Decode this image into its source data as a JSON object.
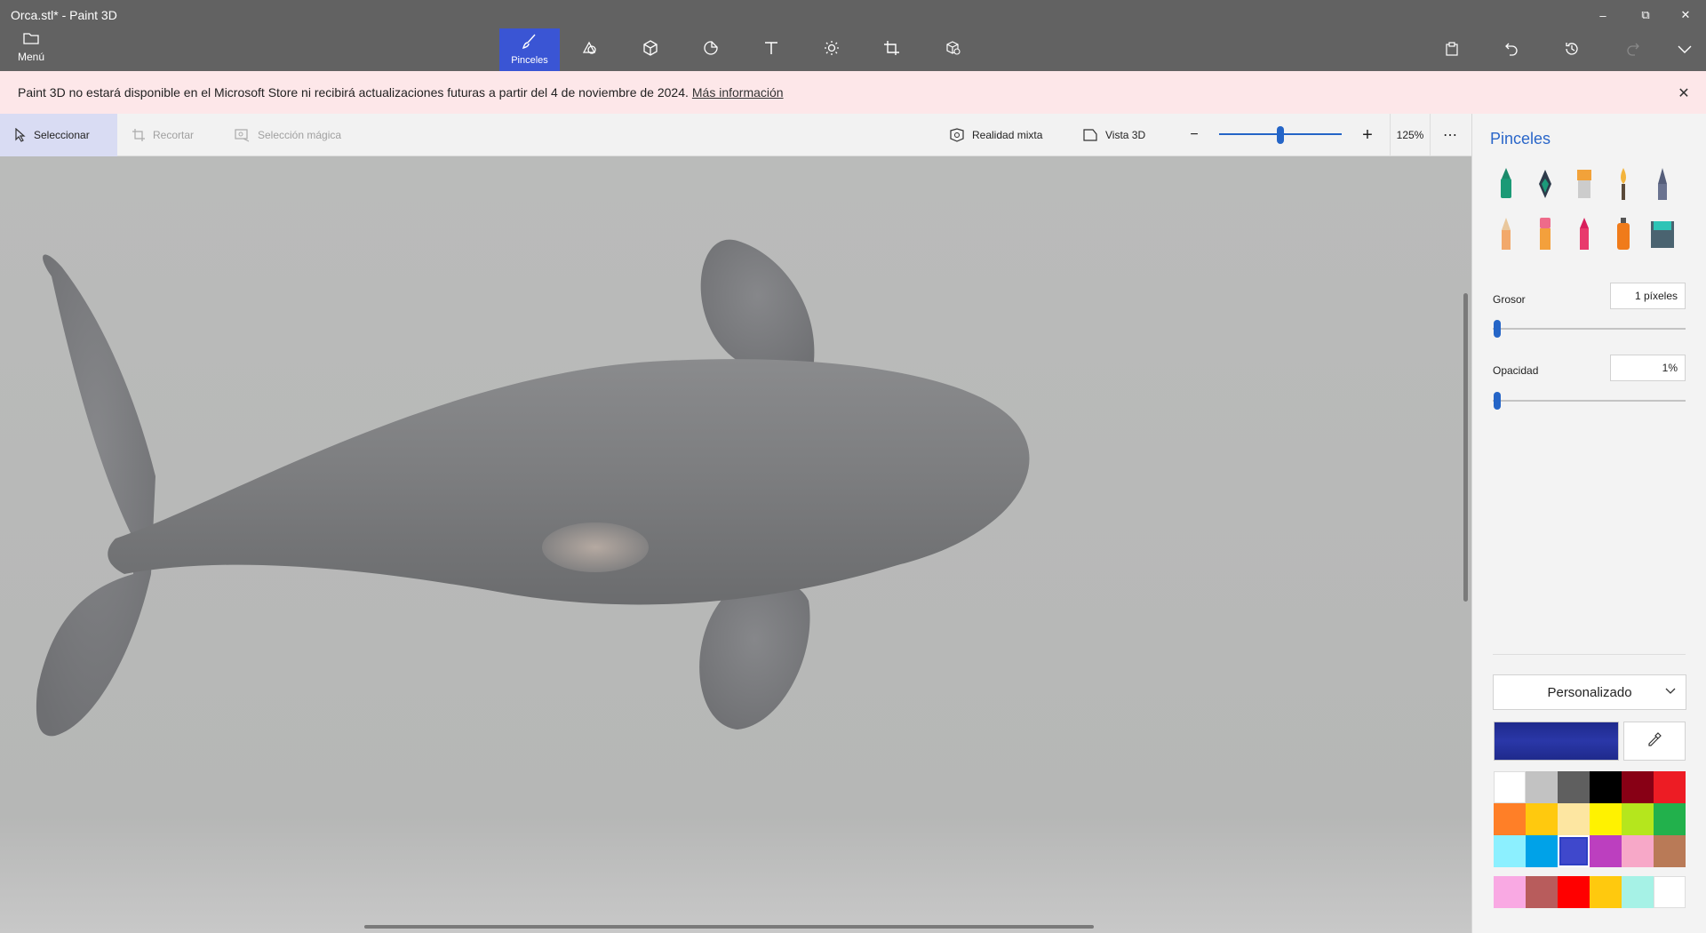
{
  "window": {
    "title": "Orca.stl* - Paint 3D"
  },
  "window_controls": {
    "minimize": "–",
    "maximize": "⧉",
    "close": "✕"
  },
  "menu": {
    "label": "Menú"
  },
  "tools": [
    {
      "name": "brushes",
      "label": "Pinceles",
      "icon": "brush-icon",
      "active": true
    },
    {
      "name": "2d-shapes",
      "icon": "2d-shapes-icon"
    },
    {
      "name": "3d-shapes",
      "icon": "3d-cube-icon"
    },
    {
      "name": "stickers",
      "icon": "sticker-icon"
    },
    {
      "name": "text",
      "icon": "text-icon"
    },
    {
      "name": "effects",
      "icon": "sun-icon"
    },
    {
      "name": "canvas",
      "icon": "crop-canvas-icon"
    },
    {
      "name": "3d-library",
      "icon": "3d-library-icon"
    }
  ],
  "right_tools": [
    "paste-icon",
    "undo-icon",
    "history-icon",
    "redo-icon",
    "chevron-down-icon"
  ],
  "notice": {
    "text": "Paint 3D no estará disponible en el Microsoft Store ni recibirá actualizaciones futuras a partir del 4 de noviembre de 2024.",
    "link": "Más información",
    "close": "✕"
  },
  "subtoolbar": {
    "select": "Seleccionar",
    "crop": "Recortar",
    "magic_select": "Selección mágica",
    "mixed_reality": "Realidad mixta",
    "view3d": "Vista 3D",
    "zoom_minus": "−",
    "zoom_plus": "+",
    "zoom": "125%",
    "zoom_fraction": 0.5,
    "more": "⋯"
  },
  "panel": {
    "title": "Pinceles",
    "brushes": [
      "marker-icon",
      "calligraphy-pen-icon",
      "oil-brush-icon",
      "watercolor-icon",
      "pixel-pen-icon",
      "pencil-icon",
      "eraser-icon",
      "crayon-icon",
      "spraycan-icon",
      "fill-bucket-icon"
    ],
    "thickness_label": "Grosor",
    "thickness_value": "1 píxeles",
    "opacity_label": "Opacidad",
    "opacity_value": "1%",
    "palette_label": "Personalizado",
    "current_color": "#1f2a8c",
    "swatches": [
      "#ffffff",
      "#c2c2c2",
      "#5f5f5f",
      "#000000",
      "#880015",
      "#ed1c24",
      "#ff7f27",
      "#ffc90e",
      "#fde6a1",
      "#fff200",
      "#b5e61d",
      "#22b14c",
      "#8cf0ff",
      "#00a2e8",
      "#3f48cc",
      "#bc3fbf",
      "#f7a8c8",
      "#b97a57",
      "#f9a9e3",
      "#b85c5c",
      "#ff0000",
      "#ffc90e",
      "#a6f2e6",
      "#ffffff"
    ],
    "selected_swatch": 14
  }
}
